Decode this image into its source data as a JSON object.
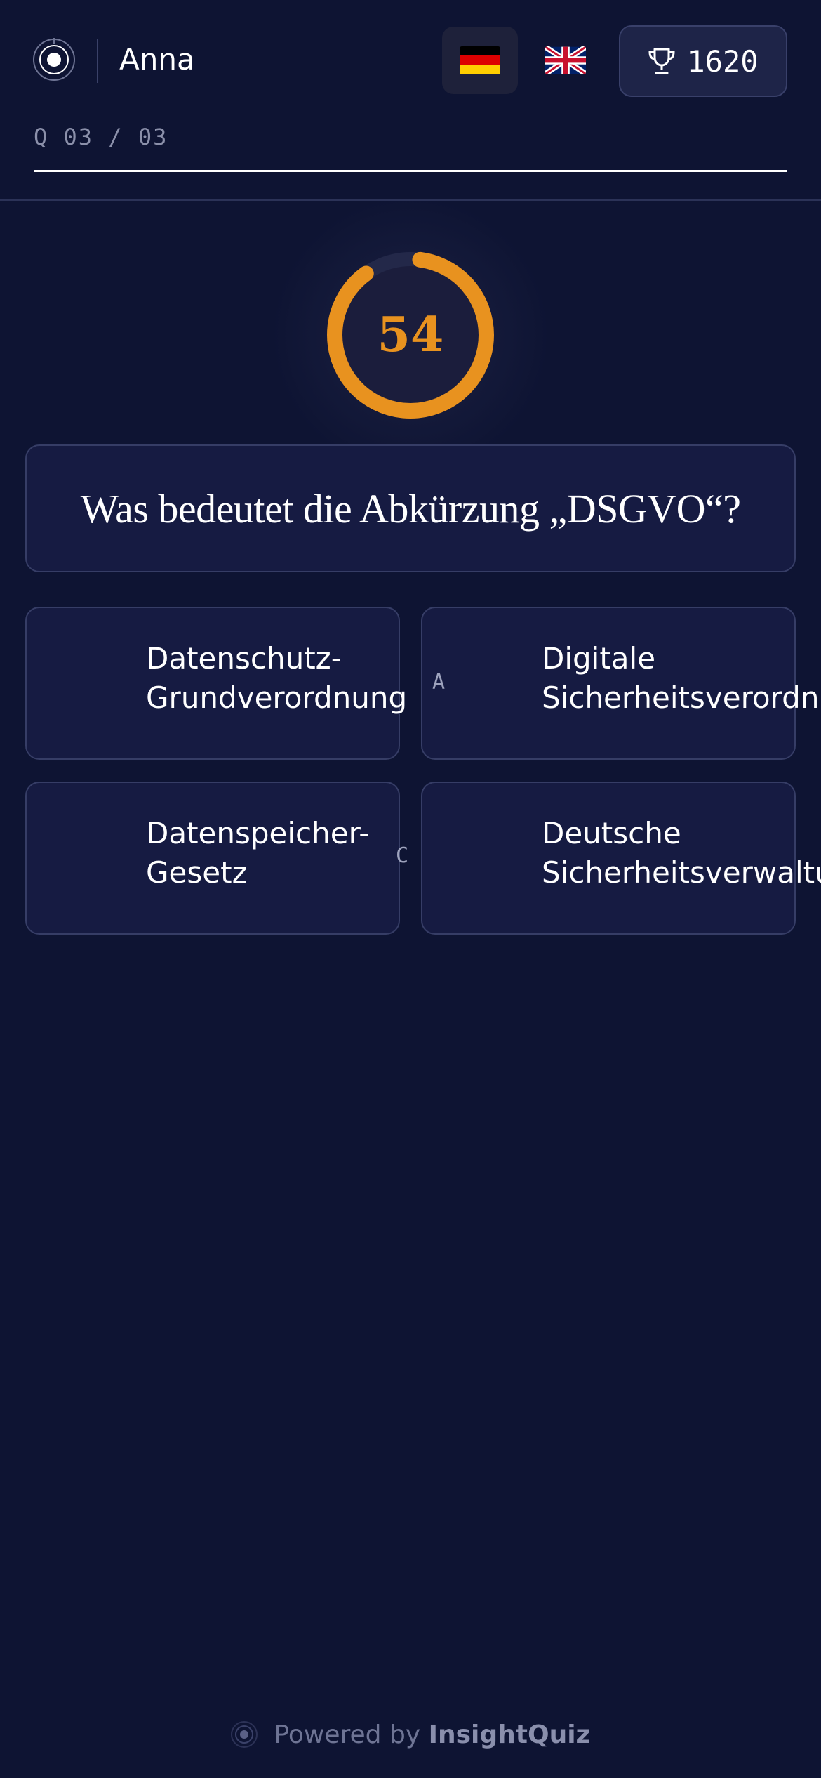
{
  "header": {
    "username": "Anna",
    "languages": [
      {
        "code": "de",
        "label": "Deutsch",
        "flag_icon": "flag-de-icon",
        "active": true
      },
      {
        "code": "en",
        "label": "English",
        "flag_icon": "flag-gb-icon",
        "active": false
      }
    ],
    "score": "1620",
    "score_icon": "trophy-icon"
  },
  "progress": {
    "text": "Q 03 / 03",
    "fraction": 1.0
  },
  "timer": {
    "value": "54",
    "remaining_fraction": 0.9,
    "color": "#e8921f"
  },
  "question": {
    "text": "Was bedeutet die Abkürzung „DSGVO“?"
  },
  "answers": [
    {
      "letter": "",
      "text": "Datenschutz-\nGrundverordnung"
    },
    {
      "letter": "A",
      "text": "Digitale\nSicherheitsverordnung"
    },
    {
      "letter": "C",
      "text": "Datenspeicher-\nGesetz"
    },
    {
      "letter": "",
      "text": "Deutsche\nSicherheitsverwaltung"
    }
  ],
  "footer": {
    "prefix": "Powered by",
    "brand": "InsightQuiz"
  },
  "colors": {
    "background": "#0e1433",
    "card": "#161b42",
    "accent": "#e8921f"
  }
}
